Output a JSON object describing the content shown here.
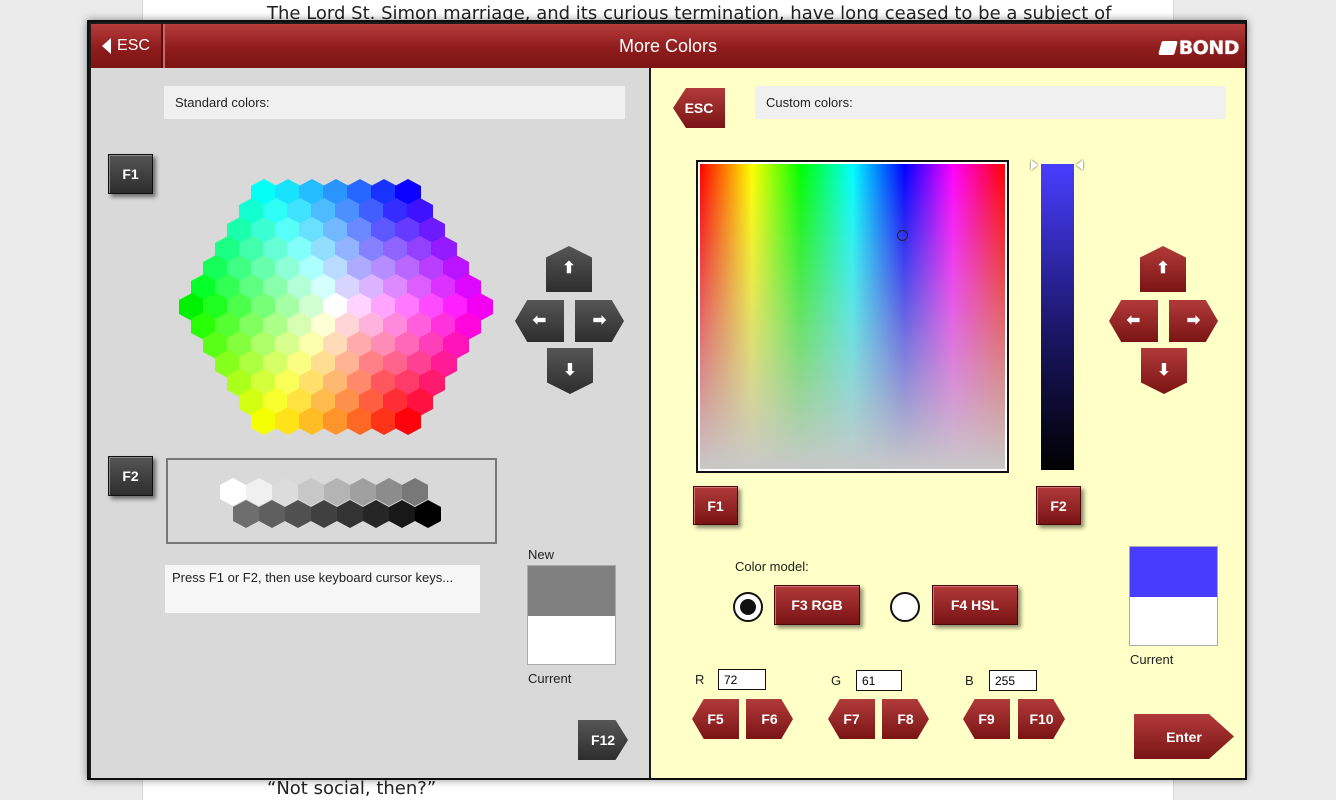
{
  "background_document": {
    "top_line": "The Lord St. Simon marriage, and its curious termination, have long ceased to be a subject of",
    "bottom_line": "“Not social, then?”"
  },
  "titlebar": {
    "esc_label": "ESC",
    "title": "More Colors",
    "logo_text": "BOND"
  },
  "left_panel": {
    "standard_label": "Standard colors:",
    "f1": "F1",
    "f2": "F2",
    "f12": "F12",
    "hint": "Press F1 or F2, then use keyboard cursor keys...",
    "new_label": "New",
    "current_label": "Current",
    "new_color": "#808080",
    "current_color": "#ffffff"
  },
  "right_panel": {
    "esc_label": "ESC",
    "custom_label": "Custom colors:",
    "f1": "F1",
    "f2": "F2",
    "color_model_label": "Color model:",
    "f3_rgb": "F3 RGB",
    "f4_hsl": "F4 HSL",
    "selected_model": "RGB",
    "r_label": "R",
    "g_label": "G",
    "b_label": "B",
    "r_value": "72",
    "g_value": "61",
    "b_value": "255",
    "f5": "F5",
    "f6": "F6",
    "f7": "F7",
    "f8": "F8",
    "f9": "F9",
    "f10": "F10",
    "enter": "Enter",
    "current_label": "Current",
    "new_color": "#483dff",
    "current_color": "#ffffff"
  },
  "arrow_icons": {
    "up": "arrow-up-icon",
    "down": "arrow-down-icon",
    "left": "arrow-left-icon",
    "right": "arrow-right-icon"
  }
}
